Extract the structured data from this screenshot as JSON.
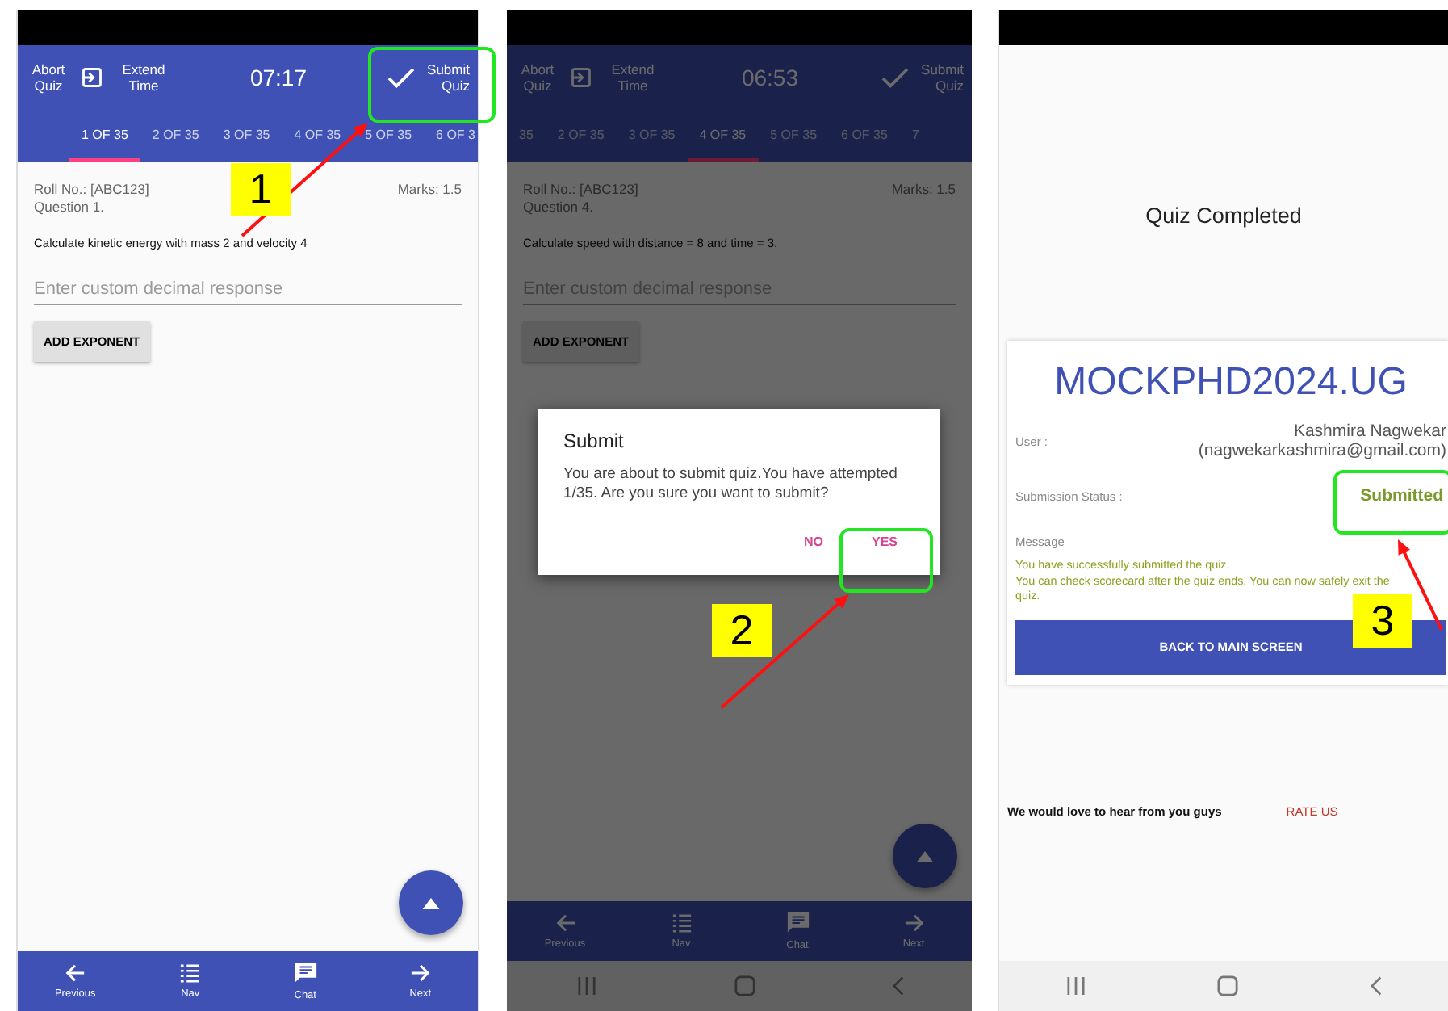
{
  "screens": [
    {
      "kind": "quiz",
      "header": {
        "abort": "Abort Quiz",
        "extend": "Extend Time",
        "timer": "07:17",
        "submit": "Submit Quiz"
      },
      "tabs": [
        {
          "label": "1 OF 35",
          "selected": true
        },
        {
          "label": "2 OF 35",
          "selected": false
        },
        {
          "label": "3 OF 35",
          "selected": false
        },
        {
          "label": "4 OF 35",
          "selected": false
        },
        {
          "label": "5 OF 35",
          "selected": false
        },
        {
          "label": "6 OF 3",
          "selected": false
        }
      ],
      "roll": "Roll No.: [ABC123]",
      "question": "Question 1.",
      "marks": "Marks: 1.5",
      "prompt": "Calculate kinetic energy with mass 2 and velocity 4",
      "placeholder": "Enter custom decimal response",
      "exponent_button": "ADD EXPONENT",
      "bottom_nav": [
        {
          "kind": "back",
          "label": "Previous"
        },
        {
          "kind": "list",
          "label": "Nav"
        },
        {
          "kind": "chat",
          "label": "Chat"
        },
        {
          "kind": "forward",
          "label": "Next"
        }
      ]
    },
    {
      "kind": "quiz",
      "header": {
        "abort": "Abort Quiz",
        "extend": "Extend Time",
        "timer": "06:53",
        "submit": "Submit Quiz"
      },
      "tabs": [
        {
          "label": "35",
          "selected": false
        },
        {
          "label": "2 OF 35",
          "selected": false
        },
        {
          "label": "3 OF 35",
          "selected": false
        },
        {
          "label": "4 OF 35",
          "selected": true
        },
        {
          "label": "5 OF 35",
          "selected": false
        },
        {
          "label": "6 OF 35",
          "selected": false
        },
        {
          "label": "7",
          "selected": false
        }
      ],
      "roll": "Roll No.: [ABC123]",
      "question": "Question 4.",
      "marks": "Marks: 1.5",
      "prompt": "Calculate speed with distance = 8 and time = 3.",
      "placeholder": "Enter custom decimal response",
      "exponent_button": "ADD EXPONENT",
      "bottom_nav": [
        {
          "kind": "back",
          "label": "Previous"
        },
        {
          "kind": "list",
          "label": "Nav"
        },
        {
          "kind": "chat",
          "label": "Chat"
        },
        {
          "kind": "forward",
          "label": "Next"
        }
      ],
      "dialog": {
        "title": "Submit",
        "message": "You are about to submit quiz.You have attempted 1/35. Are you sure you want to submit?",
        "buttons": [
          "NO",
          "YES"
        ]
      },
      "system_nav": true
    },
    {
      "kind": "completed",
      "heading": "Quiz Completed",
      "quiz_name": "MOCKPHD2024.UG",
      "user_label": "User :",
      "user_name": "Kashmira Nagwekar",
      "user_email": "(nagwekarkashmira@gmail.com)",
      "status_label": "Submission Status :",
      "status": "Submitted",
      "message_label": "Message",
      "message_lines": [
        "You have successfully submitted the quiz.",
        "You can check scorecard after the quiz ends. You can now safely exit the quiz."
      ],
      "back_button": "BACK TO MAIN SCREEN",
      "feedback": "We would love to hear from you guys",
      "rate_button": "RATE US",
      "system_nav": true
    }
  ],
  "annotations": [
    {
      "number": "1"
    },
    {
      "number": "2"
    },
    {
      "number": "3"
    }
  ]
}
